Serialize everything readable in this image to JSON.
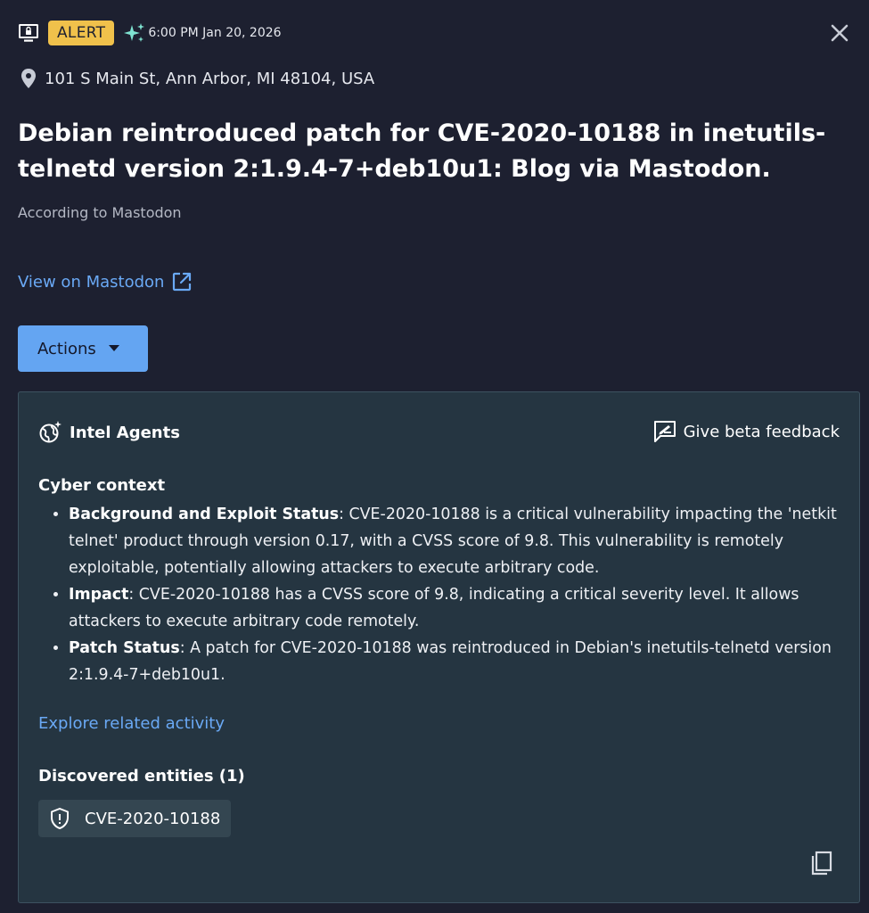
{
  "header": {
    "badge": "ALERT",
    "timestamp": "6:00 PM Jan 20, 2026",
    "icons": [
      "monitor-lock-icon",
      "sparkle-icon",
      "close-icon"
    ]
  },
  "location": {
    "address": "101 S Main St, Ann Arbor, MI 48104, USA",
    "icon": "pin-icon"
  },
  "title": "Debian reintroduced patch for CVE-2020-10188 in inetutils-telnetd version 2:1.9.4-7+deb10u1: Blog via Mastodon.",
  "source_note": "According to Mastodon",
  "view_link": {
    "label": "View on Mastodon",
    "icon": "external-link-icon"
  },
  "actions": {
    "label": "Actions",
    "icon": "caret-down-icon"
  },
  "intel_panel": {
    "title": "Intel Agents",
    "feedback_label": "Give beta feedback",
    "cyber_context_heading": "Cyber context",
    "items": [
      {
        "label": "Background and Exploit Status",
        "text": ": CVE-2020-10188 is a critical vulnerability impacting the 'netkit telnet' product through version 0.17, with a CVSS score of 9.8. This vulnerability is remotely exploitable, potentially allowing attackers to execute arbitrary code."
      },
      {
        "label": "Impact",
        "text": ": CVE-2020-10188 has a CVSS score of 9.8, indicating a critical severity level. It allows attackers to execute arbitrary code remotely."
      },
      {
        "label": "Patch Status",
        "text": ": A patch for CVE-2020-10188 was reintroduced in Debian's inetutils-telnetd version 2:1.9.4-7+deb10u1."
      }
    ],
    "explore_link": "Explore related activity",
    "entities_heading": "Discovered entities (1)",
    "entities": [
      {
        "label": "CVE-2020-10188",
        "icon": "shield-icon"
      }
    ]
  },
  "colors": {
    "background": "#1d2030",
    "panel": "#253541",
    "badge": "#f0c14b",
    "link": "#6aa9f5",
    "primary_button": "#64a5f2",
    "sparkle": "#7fe3d1"
  }
}
